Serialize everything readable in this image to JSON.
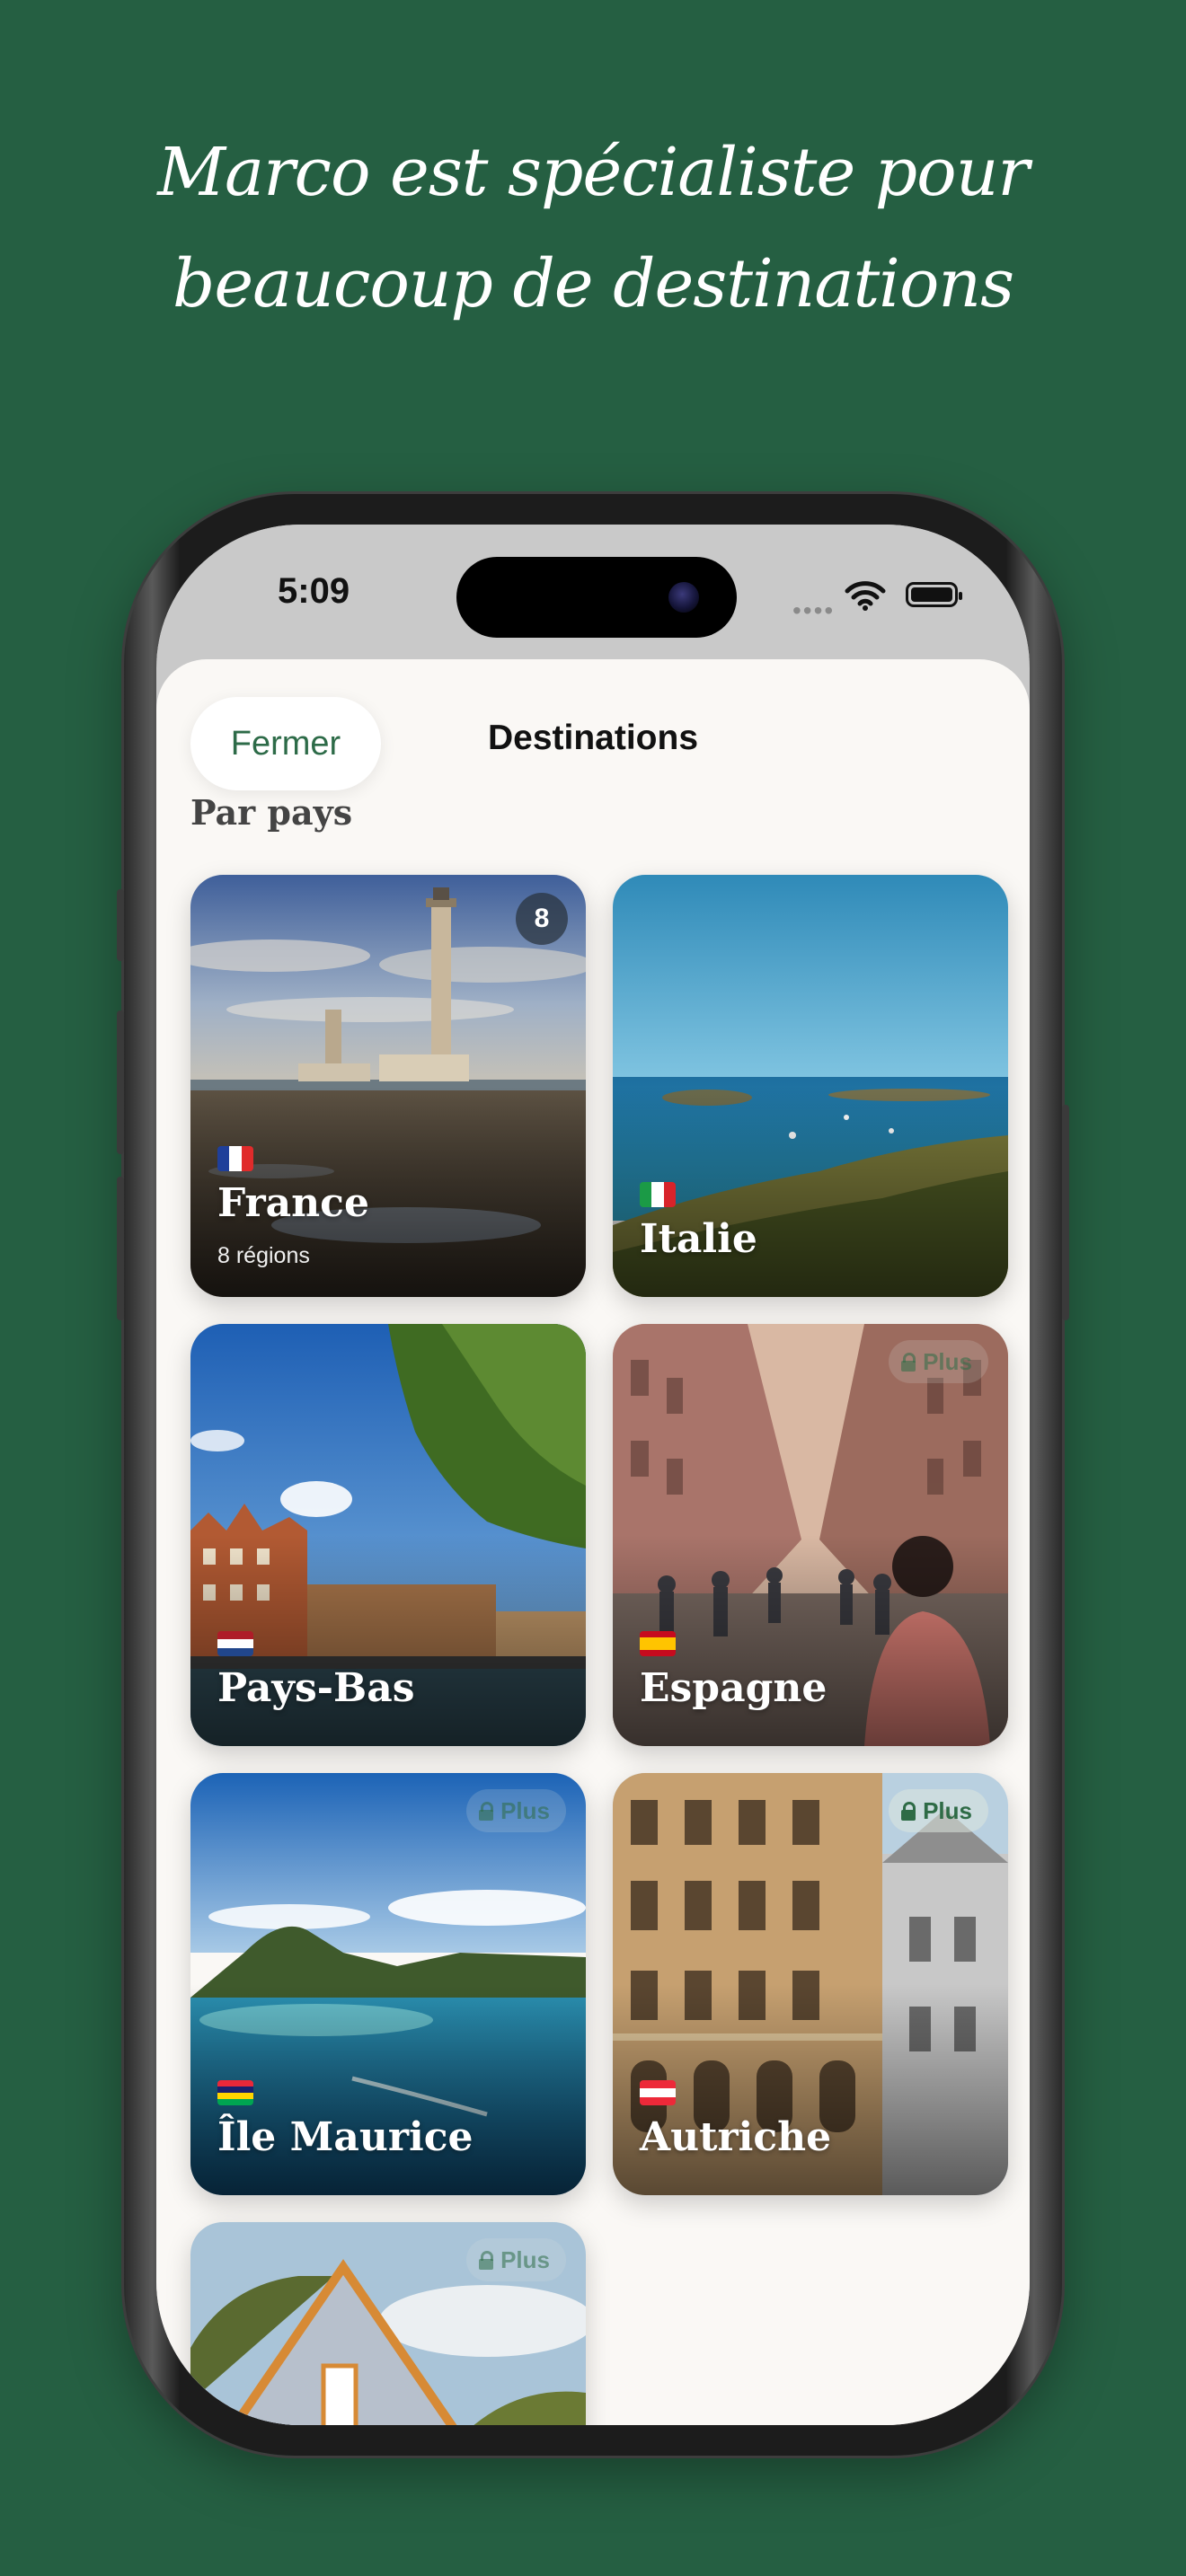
{
  "headline": "Marco est spécialiste pour beaucoup de destinations",
  "status_bar": {
    "time": "5:09",
    "signal": "••••"
  },
  "sheet": {
    "close_label": "Fermer",
    "title": "Destinations",
    "section_label": "Par pays"
  },
  "cards": [
    {
      "name": "France",
      "subtitle": "8 régions",
      "badge": "8",
      "flag": "france-flag-icon",
      "locked": false
    },
    {
      "name": "Italie",
      "flag": "italy-flag-icon",
      "locked": false
    },
    {
      "name": "Pays-Bas",
      "flag": "netherlands-flag-icon",
      "locked": false
    },
    {
      "name": "Espagne",
      "flag": "spain-flag-icon",
      "locked": true,
      "lock_label": "Plus"
    },
    {
      "name": "Île Maurice",
      "flag": "mauritius-flag-icon",
      "locked": true,
      "lock_label": "Plus"
    },
    {
      "name": "Autriche",
      "flag": "austria-flag-icon",
      "locked": true,
      "lock_label": "Plus"
    },
    {
      "name": "",
      "flag": "",
      "locked": true,
      "lock_label": "Plus"
    }
  ],
  "colors": {
    "background": "#255f42",
    "accent": "#2d6b48",
    "sheet": "#faf8f5"
  }
}
